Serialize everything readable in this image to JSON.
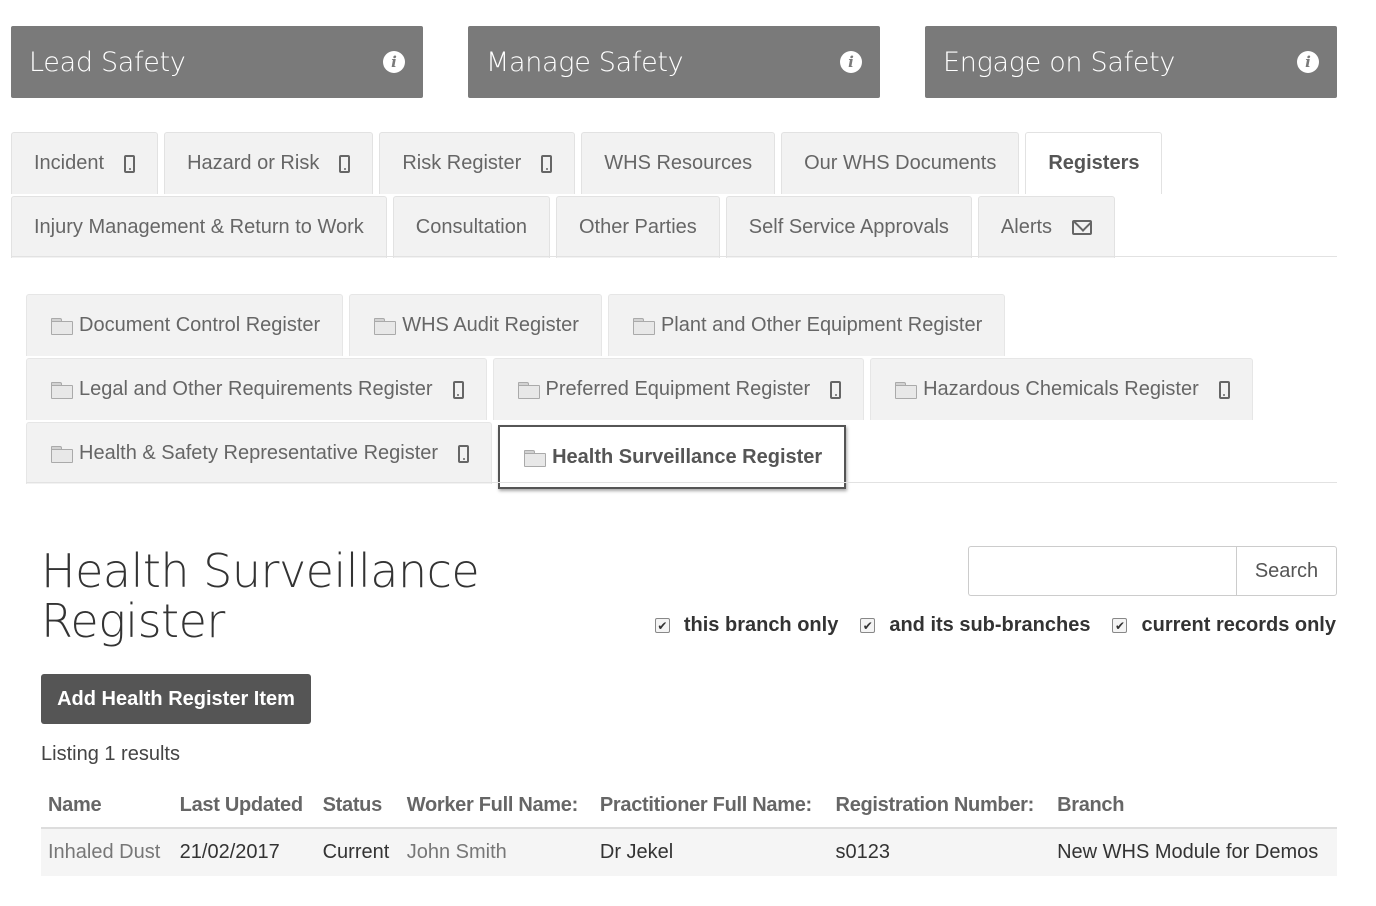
{
  "top_buttons": [
    {
      "label": "Lead Safety",
      "icon": "info-icon"
    },
    {
      "label": "Manage Safety",
      "icon": "info-icon"
    },
    {
      "label": "Engage on Safety",
      "icon": "info-icon"
    }
  ],
  "nav": {
    "row1": [
      {
        "label": "Incident",
        "icon": "mobile-icon"
      },
      {
        "label": "Hazard or Risk",
        "icon": "mobile-icon"
      },
      {
        "label": "Risk Register",
        "icon": "mobile-icon"
      },
      {
        "label": "WHS Resources"
      },
      {
        "label": "Our WHS Documents"
      },
      {
        "label": "Registers",
        "active": true
      }
    ],
    "row2": [
      {
        "label": "Injury Management & Return to Work"
      },
      {
        "label": "Consultation"
      },
      {
        "label": "Other Parties"
      },
      {
        "label": "Self Service Approvals"
      },
      {
        "label": "Alerts",
        "icon": "envelope-icon"
      }
    ]
  },
  "registers": {
    "row1": [
      {
        "label": "Document Control Register"
      },
      {
        "label": "WHS Audit Register"
      },
      {
        "label": "Plant and Other Equipment Register"
      }
    ],
    "row2": [
      {
        "label": "Legal and Other Requirements Register",
        "icon": "mobile-icon"
      },
      {
        "label": "Preferred Equipment Register",
        "icon": "mobile-icon"
      },
      {
        "label": "Hazardous Chemicals Register",
        "icon": "mobile-icon"
      }
    ],
    "row3": [
      {
        "label": "Health & Safety Representative Register",
        "icon": "mobile-icon"
      },
      {
        "label": "Health Surveillance Register",
        "active": true
      }
    ]
  },
  "page": {
    "title": "Health Surveillance Register",
    "search": {
      "value": "",
      "placeholder": "",
      "button_label": "Search"
    },
    "filters": [
      {
        "label": "this branch only",
        "checked": true
      },
      {
        "label": "and its sub-branches",
        "checked": true
      },
      {
        "label": "current records only",
        "checked": true
      }
    ],
    "add_button_label": "Add Health Register Item",
    "listing_text": "Listing 1 results"
  },
  "table": {
    "columns": [
      "Name",
      "Last Updated",
      "Status",
      "Worker Full Name:",
      "Practitioner Full Name:",
      "Registration Number:",
      "Branch"
    ],
    "rows": [
      [
        "Inhaled Dust",
        "21/02/2017",
        "Current",
        "John Smith",
        "Dr Jekel",
        "s0123",
        "New WHS Module for Demos"
      ]
    ]
  },
  "colors": {
    "top_button_bg": "#7a7a7a",
    "primary_button_bg": "#555555",
    "tab_bg": "#f2f2f2"
  }
}
